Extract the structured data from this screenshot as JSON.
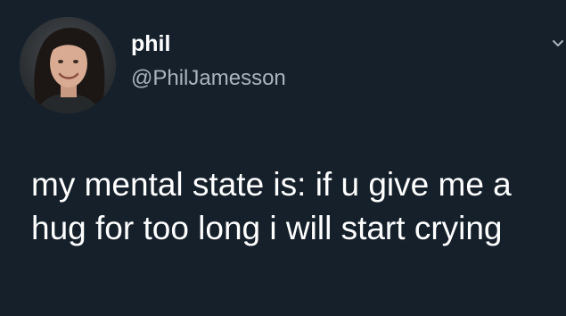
{
  "tweet": {
    "author": {
      "display_name": "phil",
      "handle": "@PhilJamesson",
      "avatar_icon": "profile-photo"
    },
    "text": "my mental state is: if u give me a hug for too long i will start crying",
    "menu_icon": "chevron-down-icon"
  },
  "colors": {
    "background": "#15202b",
    "name": "#ffffff",
    "handle": "#a9b4be",
    "text": "#ffffff"
  }
}
